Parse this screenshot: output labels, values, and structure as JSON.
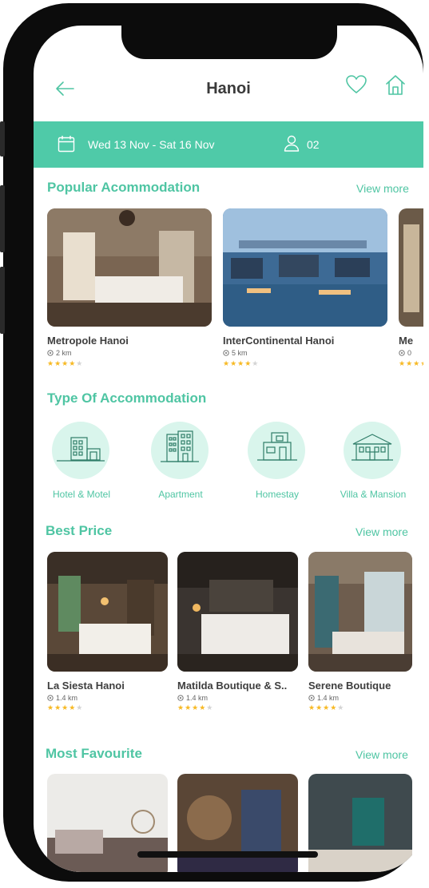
{
  "header": {
    "title": "Hanoi"
  },
  "booking": {
    "dates": "Wed 13 Nov - Sat 16 Nov",
    "guests": "02"
  },
  "popular": {
    "title": "Popular Acommodation",
    "view_more": "View more",
    "items": [
      {
        "name": "Metropole Hanoi",
        "distance": "2 km",
        "rating": 4
      },
      {
        "name": "InterContinental Hanoi",
        "distance": "5 km",
        "rating": 4
      },
      {
        "name": "Me",
        "distance": "0",
        "rating": 4
      }
    ]
  },
  "types": {
    "title": "Type Of Accommodation",
    "items": [
      {
        "label": "Hotel & Motel",
        "icon": "hotel-icon"
      },
      {
        "label": "Apartment",
        "icon": "apartment-icon"
      },
      {
        "label": "Homestay",
        "icon": "homestay-icon"
      },
      {
        "label": "Villa & Mansion",
        "icon": "villa-icon"
      }
    ]
  },
  "best_price": {
    "title": "Best Price",
    "view_more": "View more",
    "items": [
      {
        "name": "La Siesta Hanoi",
        "distance": "1.4 km",
        "rating": 4
      },
      {
        "name": "Matilda Boutique & S..",
        "distance": "1.4 km",
        "rating": 4
      },
      {
        "name": "Serene Boutique",
        "distance": "1.4 km",
        "rating": 4
      }
    ]
  },
  "favourite": {
    "title": "Most Favourite",
    "view_more": "View more"
  },
  "colors": {
    "accent": "#4fcaa8",
    "star": "#f7b924",
    "text": "#3e3e3e"
  }
}
